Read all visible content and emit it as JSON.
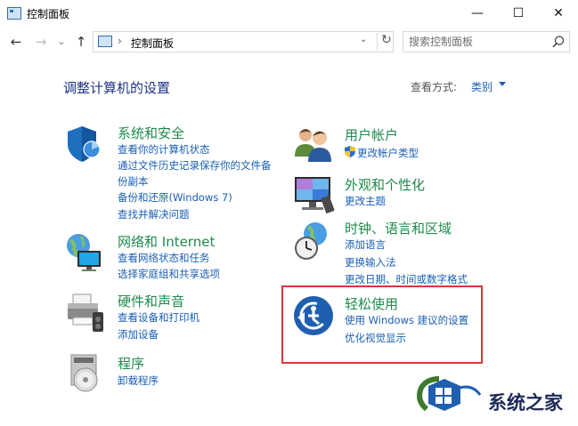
{
  "window": {
    "title": "控制面板",
    "minimize": "—",
    "maximize": "☐",
    "close": "✕"
  },
  "nav": {
    "back": "←",
    "forward": "→",
    "recent": "⌄",
    "up": "↑",
    "breadcrumb_sep": "›",
    "address": "控制面板",
    "address_dropdown": "⌄",
    "refresh": "↻",
    "search_placeholder": "搜索控制面板"
  },
  "main": {
    "heading": "调整计算机的设置",
    "view_by_label": "查看方式:",
    "view_by_value": "类别"
  },
  "categories_left": [
    {
      "title": "系统和安全",
      "icon": "shield-icon",
      "links": [
        "查看你的计算机状态",
        "通过文件历史记录保存你的文件备",
        "份副本",
        "备份和还原(Windows 7)",
        "查找并解决问题"
      ]
    },
    {
      "title": "网络和 Internet",
      "icon": "network-globe-icon",
      "links": [
        "查看网络状态和任务",
        "选择家庭组和共享选项"
      ]
    },
    {
      "title": "硬件和声音",
      "icon": "printer-icon",
      "links": [
        "查看设备和打印机",
        "添加设备"
      ]
    },
    {
      "title": "程序",
      "icon": "programs-disc-icon",
      "links": [
        "卸载程序"
      ]
    }
  ],
  "categories_right": [
    {
      "title": "用户帐户",
      "icon": "users-icon",
      "links": [
        "更改帐户类型"
      ]
    },
    {
      "title": "外观和个性化",
      "icon": "monitor-icon",
      "links": [
        "更改主题"
      ]
    },
    {
      "title": "时钟、语言和区域",
      "icon": "clock-globe-icon",
      "links": [
        "添加语言",
        "更换输入法",
        "更改日期、时间或数字格式"
      ]
    },
    {
      "title": "轻松使用",
      "icon": "ease-of-access-icon",
      "links": [
        "使用 Windows 建议的设置",
        "优化视觉显示"
      ]
    }
  ],
  "watermark": {
    "text": "系统之家"
  },
  "colors": {
    "category_title": "#1e8a4c",
    "link": "#1a5fb4",
    "heading": "#1e3287",
    "highlight_border": "#d9373c"
  }
}
